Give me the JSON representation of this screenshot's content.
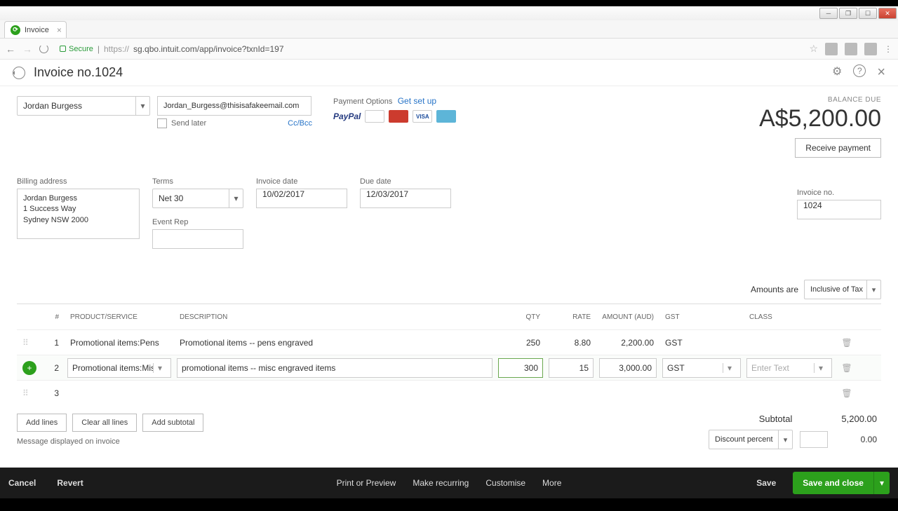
{
  "browser": {
    "tab_title": "Invoice",
    "secure_label": "Secure",
    "url_host": "https://",
    "url_main": "sg.qbo.intuit.com/app/invoice?txnId=197"
  },
  "header": {
    "title": "Invoice no.1024"
  },
  "customer": {
    "name": "Jordan Burgess",
    "email": "Jordan_Burgess@thisisafakeemail.com",
    "send_later": "Send later",
    "ccbcc": "Cc/Bcc"
  },
  "payment": {
    "label": "Payment Options",
    "link": "Get set up",
    "paypal": "PayPal"
  },
  "balance": {
    "label": "BALANCE DUE",
    "amount": "A$5,200.00",
    "receive": "Receive payment"
  },
  "fields": {
    "billing_label": "Billing address",
    "billing_value": "Jordan Burgess\n1 Success Way\nSydney NSW  2000",
    "terms_label": "Terms",
    "terms_value": "Net 30",
    "invdate_label": "Invoice date",
    "invdate_value": "10/02/2017",
    "duedate_label": "Due date",
    "duedate_value": "12/03/2017",
    "eventrep_label": "Event Rep",
    "invno_label": "Invoice no.",
    "invno_value": "1024"
  },
  "amounts_are": {
    "label": "Amounts are",
    "value": "Inclusive of Tax"
  },
  "table": {
    "headers": {
      "num": "#",
      "prod": "PRODUCT/SERVICE",
      "desc": "DESCRIPTION",
      "qty": "QTY",
      "rate": "RATE",
      "amt": "AMOUNT (AUD)",
      "gst": "GST",
      "class": "CLASS"
    },
    "rows": [
      {
        "num": "1",
        "prod": "Promotional items:Pens",
        "desc": "Promotional items -- pens engraved",
        "qty": "250",
        "rate": "8.80",
        "amt": "2,200.00",
        "gst": "GST",
        "class": ""
      },
      {
        "num": "2",
        "prod": "Promotional items:Mis",
        "desc": "promotional items -- misc engraved items",
        "qty": "300",
        "rate": "15",
        "amt": "3,000.00",
        "gst": "GST",
        "class": "Enter Text"
      },
      {
        "num": "3",
        "prod": "",
        "desc": "",
        "qty": "",
        "rate": "",
        "amt": "",
        "gst": "",
        "class": ""
      }
    ]
  },
  "line_buttons": {
    "add": "Add lines",
    "clear": "Clear all lines",
    "subtotal": "Add subtotal"
  },
  "totals": {
    "subtotal_label": "Subtotal",
    "subtotal_value": "5,200.00",
    "discount_label": "Discount percent",
    "discount_value": "0.00"
  },
  "message_label": "Message displayed on invoice",
  "footer": {
    "cancel": "Cancel",
    "revert": "Revert",
    "print": "Print or Preview",
    "recurring": "Make recurring",
    "customise": "Customise",
    "more": "More",
    "save": "Save",
    "saveclose": "Save and close"
  }
}
